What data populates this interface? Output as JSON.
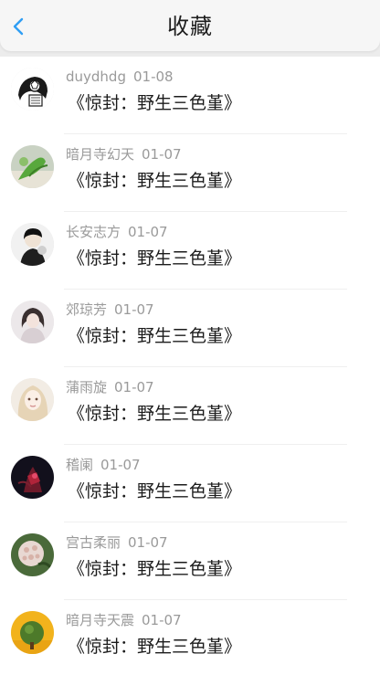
{
  "header": {
    "title": "收藏",
    "back_icon": "chevron-left-icon",
    "accent": "#2f9ef4"
  },
  "items": [
    {
      "user": "duydhdg",
      "date": "01-08",
      "book": "《惊封：野生三色堇》"
    },
    {
      "user": "暗月寺幻天",
      "date": "01-07",
      "book": "《惊封：野生三色堇》"
    },
    {
      "user": "长安志方",
      "date": "01-07",
      "book": "《惊封：野生三色堇》"
    },
    {
      "user": "郊琼芳",
      "date": "01-07",
      "book": "《惊封：野生三色堇》"
    },
    {
      "user": "蒲雨旋",
      "date": "01-07",
      "book": "《惊封：野生三色堇》"
    },
    {
      "user": "稽阑",
      "date": "01-07",
      "book": "《惊封：野生三色堇》"
    },
    {
      "user": "宫古柔丽",
      "date": "01-07",
      "book": "《惊封：野生三色堇》"
    },
    {
      "user": "暗月寺天震",
      "date": "01-07",
      "book": "《惊封：野生三色堇》"
    }
  ]
}
